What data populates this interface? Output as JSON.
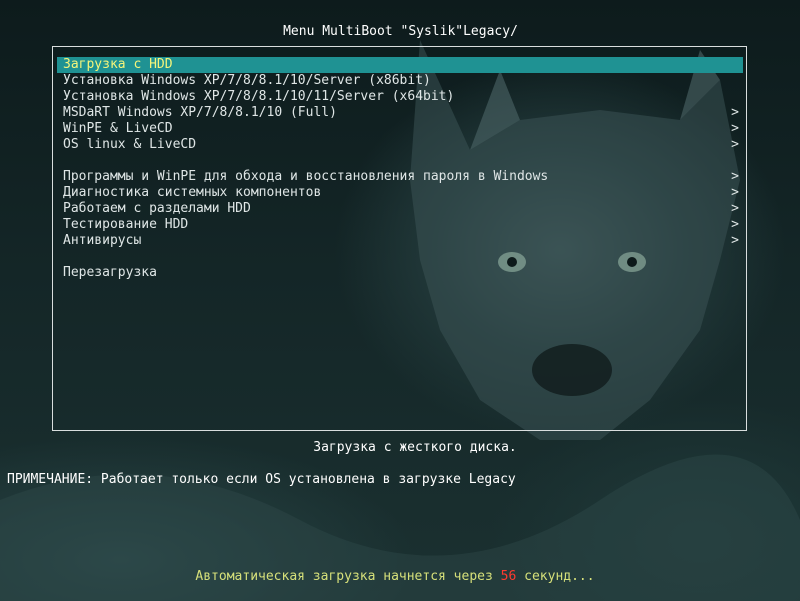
{
  "menu": {
    "title": "Menu MultiBoot \"Syslik\"Legacy/",
    "items": [
      {
        "label": "Загрузка с HDD",
        "submenu": false,
        "selected": true
      },
      {
        "label": "Установка Windows XP/7/8/8.1/10/Server (x86bit)",
        "submenu": false
      },
      {
        "label": "Установка Windows XP/7/8/8.1/10/11/Server (x64bit)",
        "submenu": false
      },
      {
        "label": "MSDaRT Windows XP/7/8/8.1/10 (Full)",
        "submenu": true
      },
      {
        "label": "WinPE & LiveCD",
        "submenu": true
      },
      {
        "label": "OS linux & LiveCD",
        "submenu": true
      },
      {
        "label": "",
        "spacer": true
      },
      {
        "label": "Программы и WinPE для обхода и восстановления пароля в Windows",
        "submenu": true
      },
      {
        "label": "Диагностика системных компонентов",
        "submenu": true
      },
      {
        "label": "Работаем с разделами HDD",
        "submenu": true
      },
      {
        "label": "Тестирование HDD",
        "submenu": true
      },
      {
        "label": "Антивирусы",
        "submenu": true
      },
      {
        "label": "",
        "spacer": true
      },
      {
        "label": "Перезагрузка",
        "submenu": false
      }
    ],
    "submenu_arrow": ">"
  },
  "description": "Загрузка с жесткого диска.",
  "note": "ПРИМЕЧАНИЕ: Работает только если OS установлена в загрузке Legacy",
  "countdown": {
    "prefix": "Автоматическая загрузка начнется через ",
    "seconds": "56",
    "suffix": " секунд..."
  },
  "colors": {
    "selected_bg": "#1f9293",
    "selected_text": "#f5f57a",
    "countdown_text": "#d6e07a",
    "countdown_number": "#ff3a2f"
  }
}
